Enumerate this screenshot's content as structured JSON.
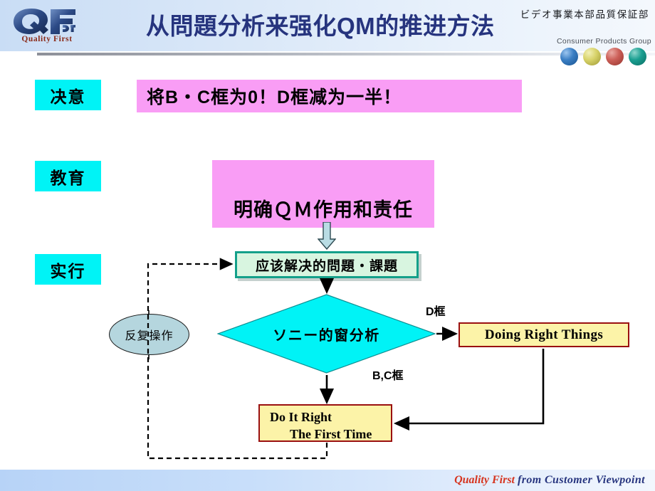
{
  "slide": {
    "title": "从問題分析来强化QM的推进方法",
    "department": "ビデオ事業本部品質保証部",
    "logo": {
      "mark_icon": "qf-logo-icon",
      "tagline": "Quality First"
    },
    "brand": {
      "group_label": "Consumer Products Group",
      "sphere_colors": [
        "#3b7fc4",
        "#d8d36a",
        "#cc5f58",
        "#1a9f91"
      ],
      "sphere_names": [
        "sphere-blue",
        "sphere-yellow",
        "sphere-red",
        "sphere-teal"
      ]
    },
    "footer": {
      "accent_text": "Quality First",
      "rest_text": " from Customer  Viewpoint"
    }
  },
  "stages": [
    {
      "label": "决意"
    },
    {
      "label": "教育"
    },
    {
      "label": "实行"
    }
  ],
  "statements": {
    "resolve": "将B・C框为0！D框减为一半！",
    "educate": "明确ＱＭ作用和责任"
  },
  "flow": {
    "problem_box": "应该解决的問題・課題",
    "repeat_ellipse": "反复操作",
    "decision_diamond": "ソニー的窗分析",
    "branch_d_label": "D框",
    "branch_bc_label": "B,C框",
    "doing_right_things": "Doing    Right    Things",
    "do_it_right_line1": "Do It Right",
    "do_it_right_line2": "The First Time"
  },
  "colors": {
    "stage_fill": "#00f3f6",
    "statement_fill": "#f99df5",
    "problem_fill": "#d8f5e0",
    "problem_border": "#14a08a",
    "diamond_fill": "#00f3f6",
    "ellipse_fill": "#b5d6de",
    "yellow_fill": "#fcf3a8",
    "yellow_border": "#9a1010",
    "title_color": "#26347e",
    "footer_accent": "#d6341f"
  }
}
